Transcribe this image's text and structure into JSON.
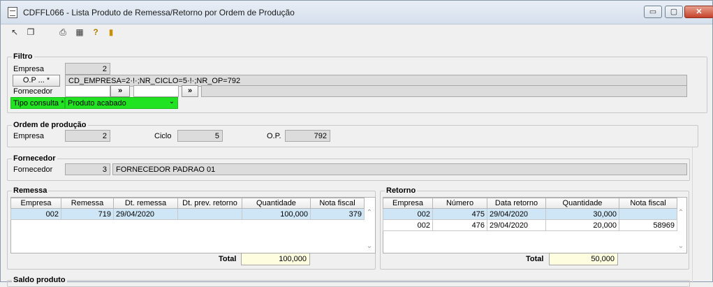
{
  "window": {
    "title": "CDFFL066 - Lista Produto de Remessa/Retorno por Ordem de Produção",
    "minimize": "▭",
    "maximize": "▢",
    "close": "✕"
  },
  "toolbar_icons": [
    "select-icon",
    "copy-icon",
    "print-icon",
    "calculator-icon",
    "help-icon",
    "exit-icon"
  ],
  "filtro": {
    "title": "Filtro",
    "empresa_label": "Empresa",
    "empresa_value": "2",
    "op_button": "O.P ... *",
    "op_value": "CD_EMPRESA=2·!·;NR_CICLO=5·!·;NR_OP=792",
    "fornecedor_label": "Fornecedor",
    "fornecedor_btn1": "»",
    "fornecedor_btn2": "»",
    "tipo_label": "Tipo consulta *",
    "tipo_value": "Produto acabado"
  },
  "ordem": {
    "title": "Ordem de produção",
    "empresa_label": "Empresa",
    "empresa_value": "2",
    "ciclo_label": "Ciclo",
    "ciclo_value": "5",
    "op_label": "O.P.",
    "op_value": "792"
  },
  "fornecedor": {
    "title": "Fornecedor",
    "label": "Fornecedor",
    "code": "3",
    "name": "FORNECEDOR PADRAO 01"
  },
  "remessa": {
    "title": "Remessa",
    "columns": [
      "Empresa",
      "Remessa",
      "Dt. remessa",
      "Dt. prev. retorno",
      "Quantidade",
      "Nota fiscal"
    ],
    "rows": [
      [
        "002",
        "719",
        "29/04/2020",
        "",
        "100,000",
        "379"
      ]
    ],
    "total_label": "Total",
    "total_value": "100,000"
  },
  "retorno": {
    "title": "Retorno",
    "columns": [
      "Empresa",
      "Número",
      "Data retorno",
      "Quantidade",
      "Nota fiscal"
    ],
    "rows": [
      [
        "002",
        "475",
        "29/04/2020",
        "30,000",
        ""
      ],
      [
        "002",
        "476",
        "29/04/2020",
        "20,000",
        "58969"
      ]
    ],
    "total_label": "Total",
    "total_value": "50,000"
  },
  "saldo": {
    "title": "Saldo produto"
  }
}
